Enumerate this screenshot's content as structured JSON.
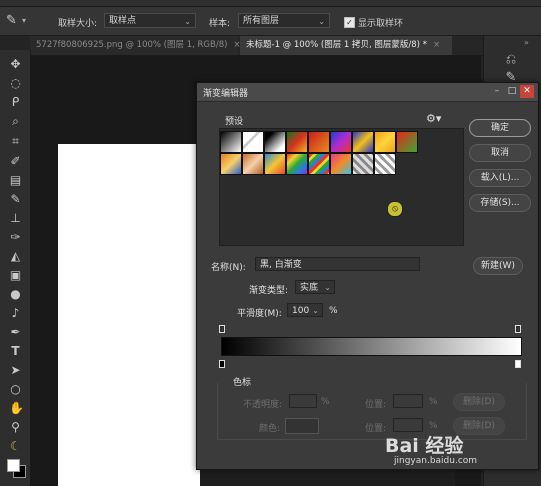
{
  "options_bar": {
    "sample_size_label": "取样大小:",
    "sample_size_value": "取样点",
    "sample_label": "样本:",
    "sample_value": "所有图层",
    "show_ring_label": "显示取样环"
  },
  "tabs": [
    {
      "label": "5727f80806925.png @ 100% (图层 1, RGB/8)",
      "close": "×"
    },
    {
      "label": "未标题-1 @ 100% (图层 1 拷贝, 图层蒙版/8) *",
      "close": "×"
    }
  ],
  "dialog": {
    "title": "渐变编辑器",
    "presets_label": "预设",
    "ok_label": "确定",
    "cancel_label": "取消",
    "load_label": "载入(L)...",
    "save_label": "存储(S)...",
    "name_label": "名称(N):",
    "name_value": "黑, 白渐变",
    "new_label": "新建(W)",
    "type_label": "渐变类型:",
    "type_value": "实底",
    "smooth_label": "平滑度(M):",
    "smooth_value": "100",
    "smooth_unit": "%",
    "color_stops_label": "色标",
    "opacity_label": "不透明度:",
    "opacity_unit": "%",
    "location_label": "位置:",
    "location_unit": "%",
    "delete_label": "删除(D)",
    "color_label": "颜色:",
    "location2_label": "位置:",
    "location2_unit": "%",
    "delete2_label": "删除(D)"
  },
  "watermark": {
    "brand": "Bai 经验",
    "url": "jingyan.baidu.com"
  }
}
